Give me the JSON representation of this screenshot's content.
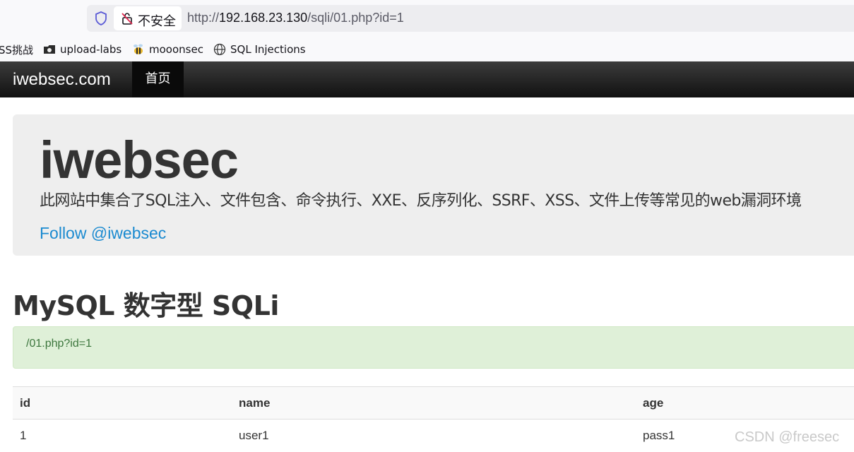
{
  "browser": {
    "security_label": "不安全",
    "url_prefix": "http://",
    "url_host": "192.168.23.130",
    "url_path": "/sqli/01.php?id=1",
    "bookmarks": [
      {
        "label": "SS挑战",
        "icon": "none"
      },
      {
        "label": "upload-labs",
        "icon": "folder-icon"
      },
      {
        "label": "mooonsec",
        "icon": "bee-icon"
      },
      {
        "label": "SQL Injections",
        "icon": "globe-icon"
      }
    ]
  },
  "navbar": {
    "brand": "iwebsec.com",
    "items": [
      "首页"
    ]
  },
  "jumbotron": {
    "title": "iwebsec",
    "description": "此网站中集合了SQL注入、文件包含、命令执行、XXE、反序列化、SSRF、XSS、文件上传等常见的web漏洞环境",
    "follow_link": "Follow @iwebsec"
  },
  "main": {
    "heading": "MySQL 数字型 SQLi",
    "alert": "/01.php?id=1",
    "table": {
      "headers": [
        "id",
        "name",
        "age"
      ],
      "rows": [
        [
          "1",
          "user1",
          "pass1"
        ]
      ]
    }
  },
  "watermark": "CSDN @freesec",
  "colors": {
    "navbar": "#222222",
    "link": "#1a8ad0",
    "alert_bg": "#dff0d8",
    "alert_text": "#3c763d"
  }
}
